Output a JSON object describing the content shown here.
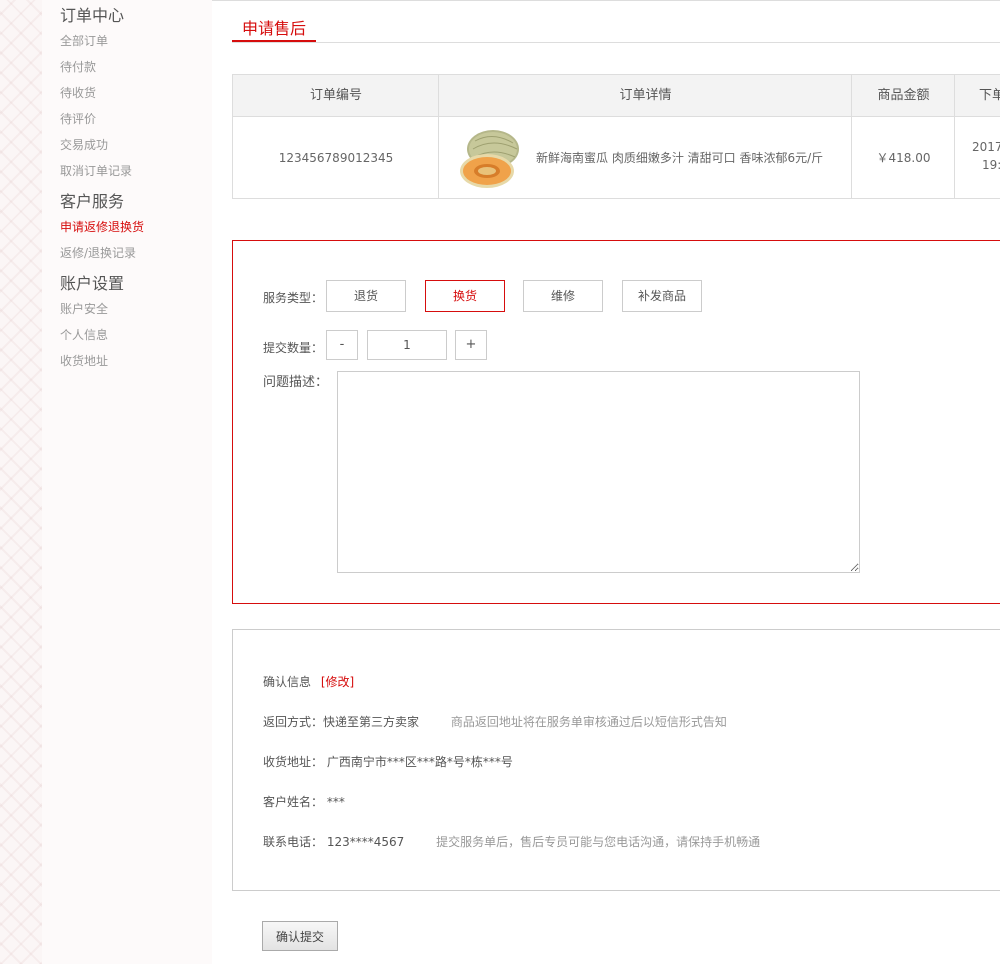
{
  "sidebar": {
    "order_center": "订单中心",
    "order_links": [
      "全部订单",
      "待付款",
      "待收货",
      "待评价",
      "交易成功",
      "取消订单记录"
    ],
    "customer_service": "客户服务",
    "service_links": [
      "申请返修退换货",
      "返修/退换记录"
    ],
    "account_settings": "账户设置",
    "account_links": [
      "账户安全",
      "个人信息",
      "收货地址"
    ]
  },
  "tab": {
    "title": "申请售后"
  },
  "order_table": {
    "headers": [
      "订单编号",
      "订单详情",
      "商品金额",
      "下单"
    ],
    "row": {
      "order_no": "123456789012345",
      "product": "新鲜海南蜜瓜 肉质细嫩多汁 清甜可口 香味浓郁6元/斤",
      "amount": "￥418.00",
      "date": "2017",
      "time": "19:"
    }
  },
  "form": {
    "service_type_label": "服务类型：",
    "service_types": [
      "退货",
      "换货",
      "维修",
      "补发商品"
    ],
    "selected_service": "换货",
    "quantity_label": "提交数量：",
    "minus": "-",
    "quantity": "1",
    "plus": "+",
    "desc_label": "问题描述："
  },
  "confirm": {
    "title": "确认信息",
    "modify": "[修改]",
    "return_method": "返回方式：快递至第三方卖家",
    "return_note": "商品返回地址将在服务单审核通过后以短信形式告知",
    "address": "收货地址：  广西南宁市***区***路*号*栋***号",
    "name": "客户姓名：  ***",
    "phone": "联系电话：  123****4567",
    "phone_note": "提交服务单后，售后专员可能与您电话沟通，请保持手机畅通"
  },
  "submit": {
    "label": "确认提交"
  },
  "colors": {
    "accent": "#d60d0d",
    "border": "#dddddd",
    "header_bg": "#f3f3f3"
  }
}
